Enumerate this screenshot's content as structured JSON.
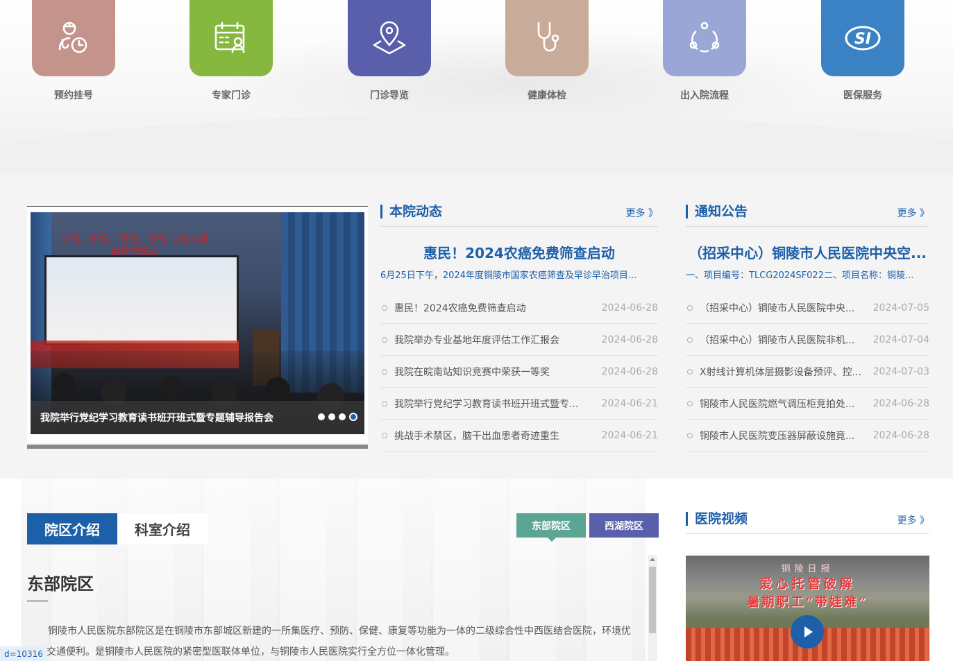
{
  "services": [
    {
      "label": "预约挂号",
      "icon": "appointment-clock-icon",
      "color": "#c4938b"
    },
    {
      "label": "专家门诊",
      "icon": "calendar-expert-icon",
      "color": "#86b840"
    },
    {
      "label": "门诊导览",
      "icon": "map-pin-icon",
      "color": "#5a5fab"
    },
    {
      "label": "健康体检",
      "icon": "stethoscope-icon",
      "color": "#c9ab9a"
    },
    {
      "label": "出入院流程",
      "icon": "process-cycle-icon",
      "color": "#9aa7d6"
    },
    {
      "label": "医保服务",
      "icon": "social-insurance-icon",
      "color": "#3a82c4"
    }
  ],
  "slider": {
    "caption": "我院举行党纪学习教育读书班开班式暨专题辅导报告会",
    "screen_text": "学纪、知纪、明纪、守纪 心有戒常自律守医心",
    "dots": 4,
    "active_dot": 4
  },
  "news": {
    "title": "本院动态",
    "more": "更多 》",
    "headline": "惠民！2024农癌免费筛查启动",
    "summary": "6月25日下午，2024年度铜陵市国家农癌筛查及早诊早治项目...",
    "items": [
      {
        "title": "惠民！2024农癌免费筛查启动",
        "date": "2024-06-28"
      },
      {
        "title": "我院举办专业基地年度评估工作汇报会",
        "date": "2024-06-28"
      },
      {
        "title": "我院在皖南站知识竞赛中荣获一等奖",
        "date": "2024-06-28"
      },
      {
        "title": "我院举行党纪学习教育读书班开班式暨专...",
        "date": "2024-06-21"
      },
      {
        "title": "挑战手术禁区，脑干出血患者奇迹重生",
        "date": "2024-06-21"
      }
    ]
  },
  "notices": {
    "title": "通知公告",
    "more": "更多 》",
    "headline": "（招采中心）铜陵市人民医院中央空...",
    "summary": "一、项目编号：TLCG2024SF022二、项目名称：铜陵...",
    "items": [
      {
        "title": "（招采中心）铜陵市人民医院中央...",
        "date": "2024-07-05"
      },
      {
        "title": "（招采中心）铜陵市人民医院非机...",
        "date": "2024-07-04"
      },
      {
        "title": "X射线计算机体层摄影设备预评、控...",
        "date": "2024-07-03"
      },
      {
        "title": "铜陵市人民医院燃气调压柜竞拍处...",
        "date": "2024-06-28"
      },
      {
        "title": "铜陵市人民医院变压器屏蔽设施竟...",
        "date": "2024-06-28"
      }
    ]
  },
  "intro": {
    "tabs": [
      "院区介绍",
      "科室介绍"
    ],
    "campus_buttons": [
      "东部院区",
      "西湖院区"
    ],
    "title": "东部院区",
    "text": "铜陵市人民医院东部院区是在铜陵市东部城区新建的一所集医疗、预防、保健、康复等功能为一体的二级综合性中西医结合医院，环境优美，交通便利。是铜陵市人民医院的紧密型医联体单位，与铜陵市人民医院实行全方位一体化管理。",
    "id_tag": "d=10316"
  },
  "video": {
    "title": "医院视频",
    "more": "更多 》",
    "thumb_line1": "铜陵日报",
    "thumb_line2": "爱心托管破解",
    "thumb_line3": "暑期职工“带娃难”"
  },
  "colors": {
    "primary": "#1d5fa9",
    "east": "#5ba595",
    "west": "#5a5fab"
  }
}
